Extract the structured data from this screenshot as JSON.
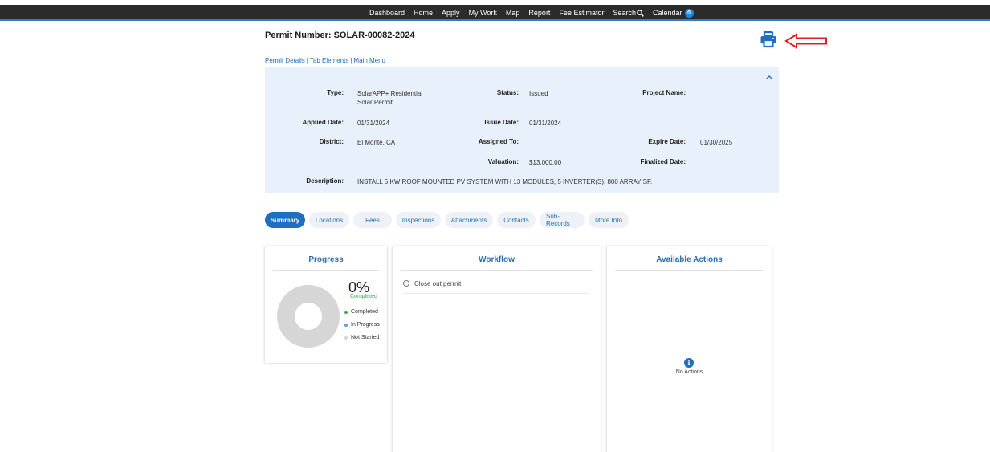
{
  "nav": {
    "items": [
      "Dashboard",
      "Home",
      "Apply",
      "My Work",
      "Map",
      "Report",
      "Fee Estimator",
      "Search",
      "Calendar"
    ],
    "calendar_count": "0"
  },
  "permit": {
    "title": "Permit Number: SOLAR-00082-2024"
  },
  "subnav": {
    "permit_details": "Permit Details",
    "tab_elements": "Tab Elements",
    "main_menu": "Main Menu",
    "separator": "|"
  },
  "details": {
    "type_label": "Type:",
    "type_value_line1": "SolarAPP+ Residential",
    "type_value_line2": "Solar Permit",
    "status_label": "Status:",
    "status_value": "Issued",
    "project_name_label": "Project Name:",
    "project_name_value": "",
    "applied_date_label": "Applied Date:",
    "applied_date_value": "01/31/2024",
    "issue_date_label": "Issue Date:",
    "issue_date_value": "01/31/2024",
    "district_label": "District:",
    "district_value": "El Monte, CA",
    "assigned_to_label": "Assigned To:",
    "assigned_to_value": "",
    "expire_date_label": "Expire Date:",
    "expire_date_value": "01/30/2025",
    "valuation_label": "Valuation:",
    "valuation_value": "$13,000.00",
    "finalized_date_label": "Finalized Date:",
    "finalized_date_value": "",
    "description_label": "Description:",
    "description_value": "INSTALL 5 KW ROOF MOUNTED PV SYSTEM WITH 13 MODULES, 5 INVERTER(S), 800 ARRAY SF."
  },
  "tabs": [
    "Summary",
    "Locations",
    "Fees",
    "Inspections",
    "Attachments",
    "Contacts",
    "Sub-Records",
    "More Info"
  ],
  "progress": {
    "title": "Progress",
    "percent": "0%",
    "percent_caption": "Completed",
    "legend": [
      "Completed",
      "In Progress",
      "Not Started"
    ],
    "colors": {
      "completed": "#3aa64f",
      "in_progress": "#5aa0d6",
      "not_started": "#d6d6d6"
    }
  },
  "workflow": {
    "title": "Workflow",
    "items": [
      "Close out permit"
    ]
  },
  "actions": {
    "title": "Available Actions",
    "empty_text": "No Actions"
  },
  "colors": {
    "accent": "#1e6fbf",
    "annotation_arrow": "#e02020"
  }
}
